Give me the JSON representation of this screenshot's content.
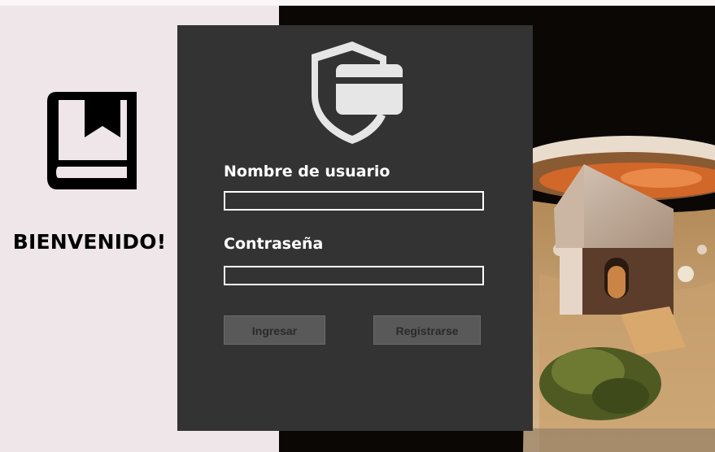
{
  "welcome": {
    "text": "BIENVENIDO!",
    "icon": "book-icon"
  },
  "login": {
    "icon": "shield-card-icon",
    "username_label": "Nombre de usuario",
    "username_value": "",
    "password_label": "Contraseña",
    "password_value": "",
    "login_button": "Ingresar",
    "register_button": "Registrarse"
  },
  "colors": {
    "background": "#efe6ea",
    "card": "#333333",
    "button": "#595959",
    "field_border": "#ffffff",
    "text_light": "#ffffff",
    "text_dark": "#000000"
  },
  "decor": {
    "photo": "miniature-house-diorama-photo"
  }
}
